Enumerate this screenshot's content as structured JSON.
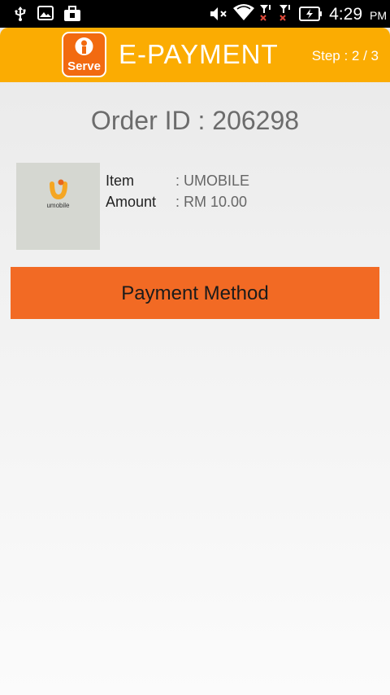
{
  "status_bar": {
    "time": "4:29",
    "ampm": "PM",
    "icons": [
      "usb-icon",
      "image-icon",
      "briefcase-icon",
      "mute-icon",
      "wifi-icon",
      "signal-icon",
      "signal-icon",
      "battery-icon"
    ]
  },
  "header": {
    "logo_text": "Serve",
    "title": "E-PAYMENT",
    "step": "Step : 2 / 3"
  },
  "order": {
    "id_text": "Order ID : 206298"
  },
  "item": {
    "thumb_text": "umobile",
    "item_label": "Item",
    "item_value": ": UMOBILE",
    "amount_label": "Amount",
    "amount_value": ": RM 10.00"
  },
  "payment_button": {
    "label": "Payment Method"
  },
  "colors": {
    "header": "#fbac02",
    "button": "#f26a24",
    "logo": "#f26a10",
    "status_bar": "#000000"
  }
}
